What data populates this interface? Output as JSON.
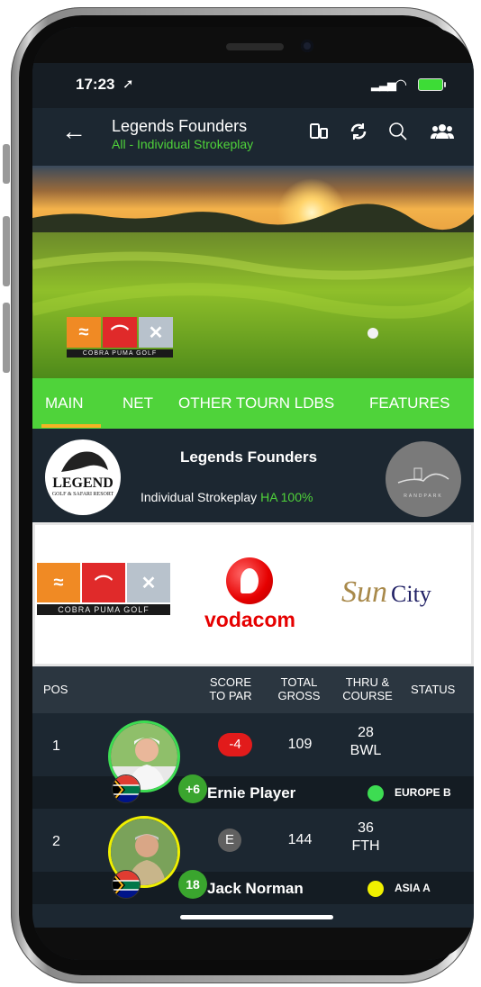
{
  "status_bar": {
    "time": "17:23",
    "location_icon": "location-arrow-icon"
  },
  "nav": {
    "title": "Legends Founders",
    "subtitle": "All - Individual Strokeplay",
    "icons": [
      "device-switch-icon",
      "refresh-icon",
      "search-icon",
      "players-group-icon"
    ]
  },
  "tabs": [
    "MAIN",
    "NET",
    "OTHER TOURN LDBS",
    "FEATURES"
  ],
  "active_tab": "MAIN",
  "event": {
    "title": "Legends Founders",
    "format": "Individual Strokeplay",
    "handicap": "HA 100%",
    "legend_logo": "LEGEND",
    "legend_logo_sub": "GOLF & SAFARI RESORT",
    "venue_logo": "RANDPARK"
  },
  "sponsors": {
    "cobra_puma": "COBRA PUMA GOLF",
    "vodacom": "vodacom",
    "suncity_script": "Sun",
    "suncity_word": "City"
  },
  "table": {
    "headers": {
      "pos": "POS",
      "score_line1": "SCORE",
      "score_line2": "TO PAR",
      "total_line1": "TOTAL",
      "total_line2": "GROSS",
      "thru_line1": "THRU &",
      "thru_line2": "COURSE",
      "status": "STATUS"
    },
    "rows": [
      {
        "pos": "1",
        "hcp": "+6",
        "score": "-4",
        "gross": "109",
        "thru": "28",
        "course": "BWL",
        "name": "Ernie Player",
        "team": "EUROPE B",
        "team_color": "#3ddc52",
        "ring_color": "#3ddc52"
      },
      {
        "pos": "2",
        "hcp": "18",
        "score": "E",
        "gross": "144",
        "thru": "36",
        "course": "FTH",
        "name": "Jack Norman",
        "team": "ASIA A",
        "team_color": "#f0f000",
        "ring_color": "#f0f000"
      }
    ]
  }
}
